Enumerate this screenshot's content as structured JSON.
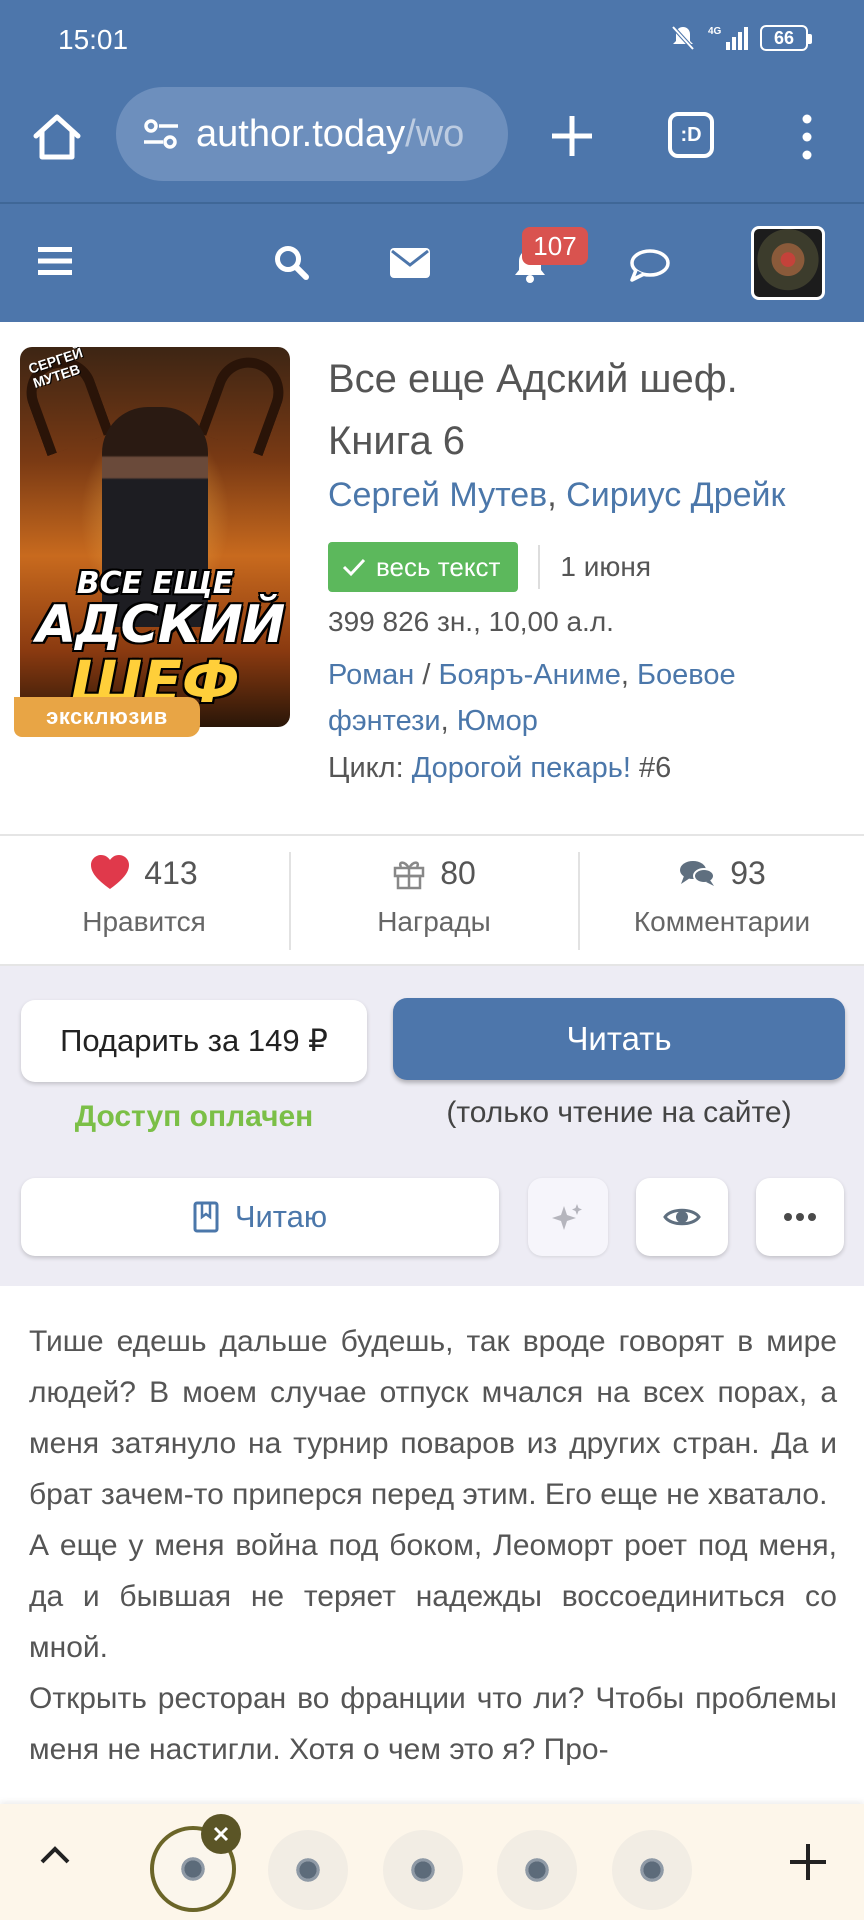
{
  "status_bar": {
    "time": "15:01",
    "network": "4G",
    "battery": "66"
  },
  "browser": {
    "url_host": "author.today",
    "url_rest": "/wo",
    "tabs_label": ":D"
  },
  "nav": {
    "notifications_count": "107"
  },
  "book": {
    "title": "Все еще Адский шеф. Книга 6",
    "authors": [
      "Сергей Мутев",
      "Сириус Дрейк"
    ],
    "authors_separator": ", ",
    "status_badge": "весь текст",
    "date": "1 июня",
    "size": "399 826 зн., 10,00 а.л.",
    "genres": {
      "g1": "Роман",
      "sep1": " / ",
      "g2": "Бояръ-Аниме",
      "sep2": ", ",
      "g3": "Боевое фэнтези",
      "sep3": ", ",
      "g4": "Юмор"
    },
    "cycle_label": "Цикл: ",
    "cycle_name": "Дорогой пекарь!",
    "cycle_number": " #6",
    "exclusive_badge": "эксклюзив",
    "cover_art": {
      "author": "СЕРГЕЙ\nМУТЕВ",
      "line1": "ВСЕ ЕЩЕ",
      "line2": "АДСКИЙ",
      "line3": "ШЕФ"
    }
  },
  "stats": {
    "likes": {
      "count": "413",
      "label": "Нравится"
    },
    "awards": {
      "count": "80",
      "label": "Награды"
    },
    "comments": {
      "count": "93",
      "label": "Комментарии"
    }
  },
  "actions": {
    "gift": "Подарить за 149 ₽",
    "read": "Читать",
    "access_paid": "Доступ оплачен",
    "read_note": "(только чтение на сайте)",
    "reading": "Читаю"
  },
  "annotation": [
    "Тише едешь дальше будешь, так вроде говорят в мире людей? В моем случае отпуск мчался на всех порах, а меня затянуло на турнир поваров из других стран. Да и брат зачем-то приперся перед этим. Его еще не хватало.",
    "А еще у меня война под боком, Леоморт роет под меня, да и бывшая не теряет надежды воссоеди­ниться со мной.",
    "Открыть ресторан во франции что ли? Чтобы про­блемы меня не настигли. Хотя о чем это я? Про-"
  ],
  "colors": {
    "header_blue": "#4d76ab",
    "link_blue": "#4b77aa",
    "green_badge": "#5cb85c",
    "access_green": "#7bbf47",
    "notif_red": "#d9534f",
    "exclusive_orange": "#e8a545",
    "heart_red": "#e0394b"
  },
  "icons": [
    "home-icon",
    "tune-icon",
    "plus-icon",
    "tabs-icon",
    "kebab-icon",
    "menu-icon",
    "search-icon",
    "mail-icon",
    "bell-icon",
    "chat-icon",
    "heart-icon",
    "gift-icon",
    "comments-icon",
    "bookmark-icon",
    "sparkle-icon",
    "eye-icon",
    "more-icon",
    "chevron-up-icon",
    "close-icon"
  ]
}
